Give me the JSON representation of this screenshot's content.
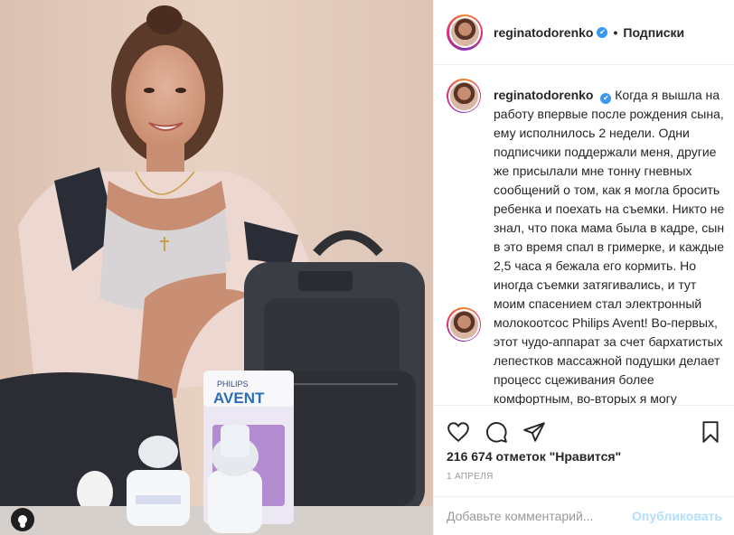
{
  "post": {
    "username": "reginatodorenko",
    "follow_state": "Подписки",
    "separator": "•",
    "verified_icon": "verified-badge-icon",
    "caption_username": "reginatodorenko",
    "caption_text": "Когда я вышла на работу впервые после рождения сына, ему исполнилось 2 недели. Одни подписчики поддержали меня, другие же присылали мне тонну гневных сообщений о том, как я могла бросить ребенка и поехать на съемки. Никто не знал, что пока мама была в кадре, сын в это время спал в гримерке, и каждые 2,5 часа я бежала его кормить. Но иногда съемки затягивались, и тут моим спасением стал электронный молокоотсос Philips Avent! Во-первых, этот чудо-аппарат за счет бархатистых лепестков массажной подушки делает процесс сцеживания более комфортным, во-вторых я могу собирать и замораживать молоко в специальных пакетах и не",
    "likes": "216 674 отметок \"Нравится\"",
    "date": "1 апреля",
    "comment_placeholder": "Добавьте комментарий...",
    "publish_label": "Опубликовать",
    "photo_texts": {
      "brand": "PHILIPS",
      "product": "AVENT"
    }
  },
  "icons": {
    "like": "heart-icon",
    "comment": "comment-icon",
    "share": "share-icon",
    "save": "bookmark-icon",
    "photo_badge": "user-tag-icon"
  },
  "colors": {
    "accent_blue": "#3897f0",
    "publish_disabled": "#b2dffc",
    "border": "#efefef",
    "muted_text": "#999999",
    "story_ring_start": "#f58529",
    "story_ring_end": "#dd2a7b"
  }
}
